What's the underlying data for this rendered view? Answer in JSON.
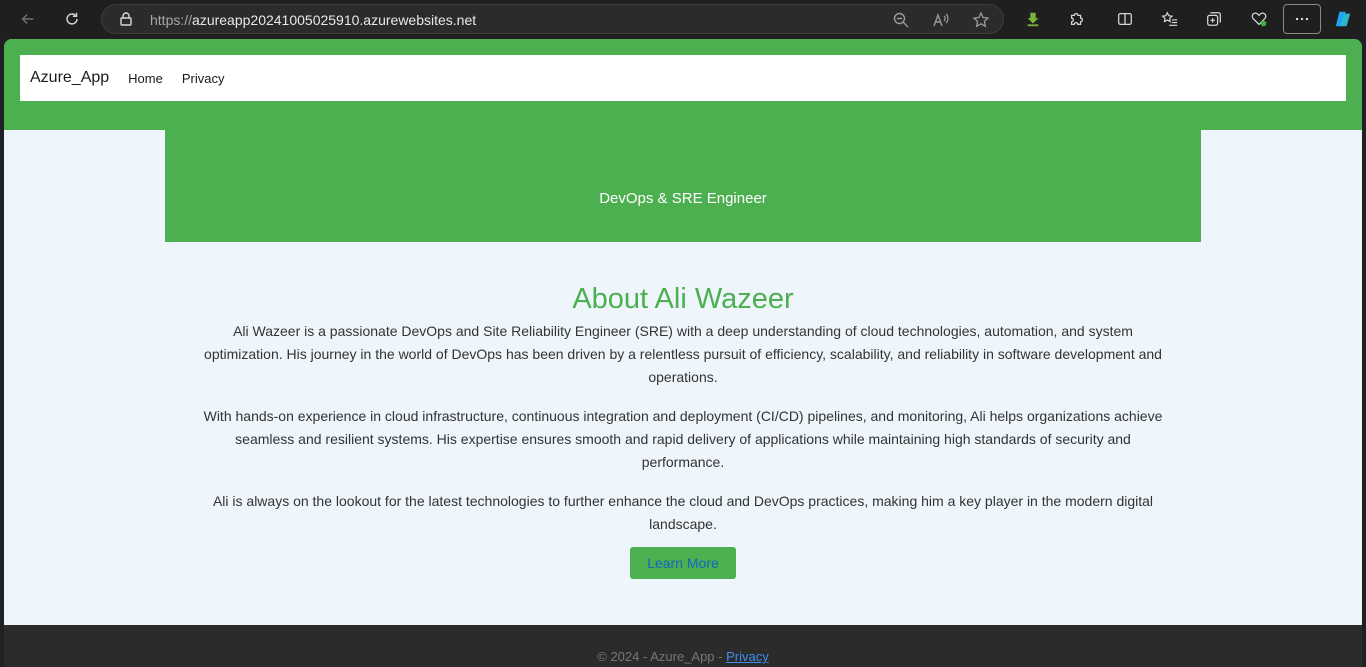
{
  "browser": {
    "url_protocol": "https://",
    "url_host": "azureapp20241005025910.azurewebsites.net"
  },
  "site": {
    "brand": "Azure_App",
    "nav": [
      "Home",
      "Privacy"
    ]
  },
  "hero": {
    "subtitle": "DevOps & SRE Engineer"
  },
  "about": {
    "title": "About Ali Wazeer",
    "paragraphs": [
      "Ali Wazeer is a passionate DevOps and Site Reliability Engineer (SRE) with a deep understanding of cloud technologies, automation, and system optimization. His journey in the world of DevOps has been driven by a relentless pursuit of efficiency, scalability, and reliability in software development and operations.",
      "With hands-on experience in cloud infrastructure, continuous integration and deployment (CI/CD) pipelines, and monitoring, Ali helps organizations achieve seamless and resilient systems. His expertise ensures smooth and rapid delivery of applications while maintaining high standards of security and performance.",
      "Ali is always on the lookout for the latest technologies to further enhance the cloud and DevOps practices, making him a key player in the modern digital landscape."
    ],
    "button": "Learn More"
  },
  "footer": {
    "text": "© 2024 - Azure_App - ",
    "link": "Privacy"
  },
  "colors": {
    "accent": "#4caf50",
    "background": "#eef6fc",
    "footer": "#2b2b2b"
  }
}
